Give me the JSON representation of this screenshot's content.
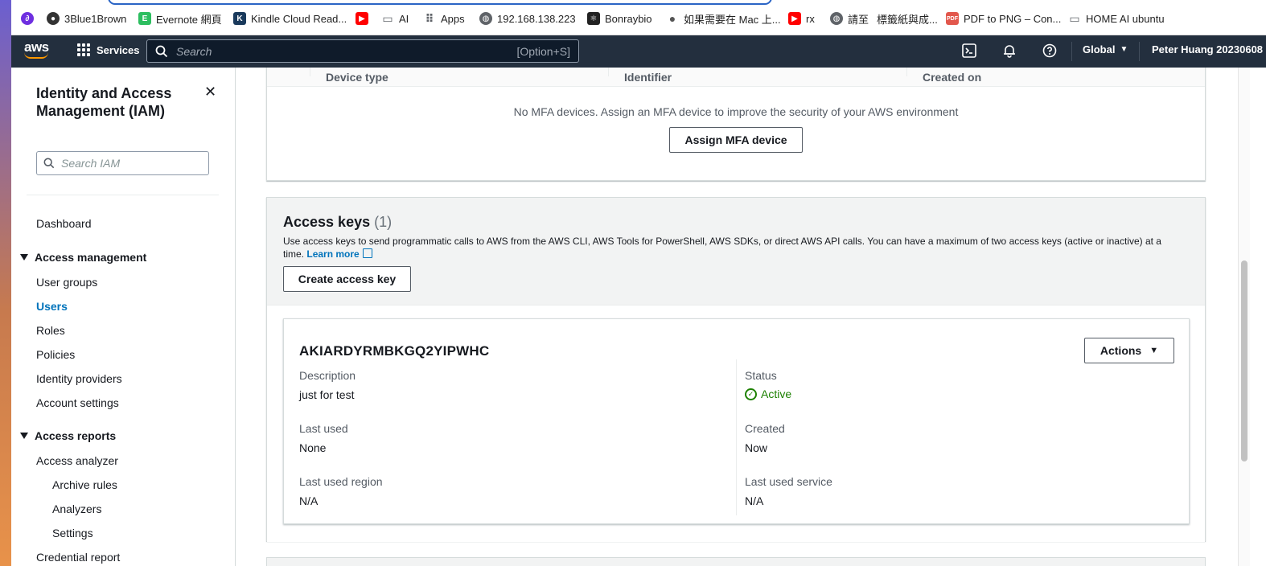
{
  "bookmarks": [
    {
      "label": "3Blue1Brown",
      "icon": "3blue1brown-icon",
      "color": "#3b3b3b"
    },
    {
      "label": "Evernote 網頁",
      "icon": "evernote-icon",
      "color": "#2dbe60"
    },
    {
      "label": "Kindle Cloud Read...",
      "icon": "kindle-icon",
      "color": "#1a3a5c"
    },
    {
      "label": "",
      "icon": "youtube-icon",
      "color": "#ff0000"
    },
    {
      "label": "AI",
      "icon": "folder-icon",
      "color": "#5f6368"
    },
    {
      "label": "Apps",
      "icon": "apps-grid-icon",
      "color": "#5f6368"
    },
    {
      "label": "192.168.138.223",
      "icon": "globe-icon",
      "color": "#5f6368"
    },
    {
      "label": "Bonraybio",
      "icon": "react-icon",
      "color": "#222"
    },
    {
      "label": "如果需要在 Mac 上...",
      "icon": "apple-icon",
      "color": "#555"
    },
    {
      "label": "rx",
      "icon": "youtube-icon",
      "color": "#ff0000"
    },
    {
      "label": "請至",
      "icon": "globe-icon",
      "color": "#5f6368"
    },
    {
      "label": "標籤紙與成...",
      "icon": "",
      "color": ""
    },
    {
      "label": "PDF to PNG – Con...",
      "icon": "pdf-icon",
      "color": "#e2574c"
    },
    {
      "label": "HOME AI ubuntu",
      "icon": "folder-icon",
      "color": "#5f6368"
    }
  ],
  "topnav": {
    "services_label": "Services",
    "search_placeholder": "Search",
    "search_shortcut": "[Option+S]",
    "region": "Global",
    "user": "Peter Huang 20230608"
  },
  "sidebar": {
    "title": "Identity and Access Management (IAM)",
    "search_placeholder": "Search IAM",
    "dashboard": "Dashboard",
    "access_management": {
      "label": "Access management",
      "items": [
        "User groups",
        "Users",
        "Roles",
        "Policies",
        "Identity providers",
        "Account settings"
      ],
      "active": "Users"
    },
    "access_reports": {
      "label": "Access reports",
      "items": [
        "Access analyzer",
        "Archive rules",
        "Analyzers",
        "Settings",
        "Credential report"
      ]
    }
  },
  "mfa": {
    "columns": [
      "Device type",
      "Identifier",
      "Created on"
    ],
    "empty_message": "No MFA devices. Assign an MFA device to improve the security of your AWS environment",
    "assign_button": "Assign MFA device"
  },
  "access_keys": {
    "title": "Access keys",
    "count": "(1)",
    "description": "Use access keys to send programmatic calls to AWS from the AWS CLI, AWS Tools for PowerShell, AWS SDKs, or direct AWS API calls. You can have a maximum of two access keys (active or inactive) at a time.",
    "learn_more": "Learn more",
    "create_button": "Create access key",
    "key": {
      "id": "AKIARDYRMBKGQ2YIPWHC",
      "actions_label": "Actions",
      "description_label": "Description",
      "description_value": "just for test",
      "last_used_label": "Last used",
      "last_used_value": "None",
      "last_used_region_label": "Last used region",
      "last_used_region_value": "N/A",
      "status_label": "Status",
      "status_value": "Active",
      "created_label": "Created",
      "created_value": "Now",
      "last_used_service_label": "Last used service",
      "last_used_service_value": "N/A"
    }
  },
  "colors": {
    "nav_bg": "#232f3e",
    "link": "#0073bb",
    "success": "#1d8102",
    "aws_orange": "#ff9900"
  }
}
